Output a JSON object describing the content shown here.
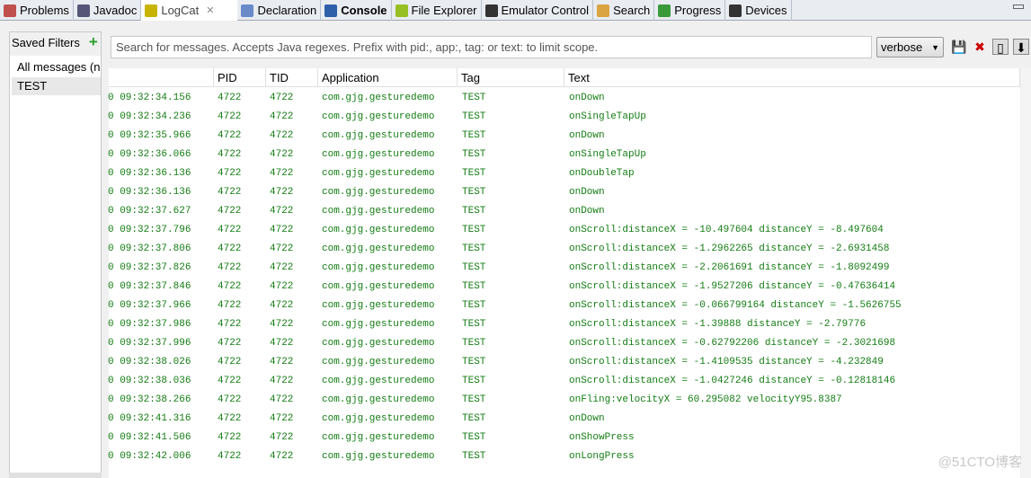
{
  "tabs": [
    {
      "label": "Problems",
      "icon": "problems-icon",
      "color": "#c0504d"
    },
    {
      "label": "Javadoc",
      "icon": "at-icon",
      "color": "#557"
    },
    {
      "label": "LogCat",
      "icon": "logcat-icon",
      "color": "#c8b400",
      "active": true
    },
    {
      "label": "Declaration",
      "icon": "declaration-icon",
      "color": "#6a8ac8"
    },
    {
      "label": "Console",
      "icon": "console-icon",
      "color": "#2e5fa8",
      "bold": true
    },
    {
      "label": "File Explorer",
      "icon": "android-icon",
      "color": "#97c024"
    },
    {
      "label": "Emulator Control",
      "icon": "emulator-icon",
      "color": "#333"
    },
    {
      "label": "Search",
      "icon": "search-icon",
      "color": "#d9a441"
    },
    {
      "label": "Progress",
      "icon": "progress-icon",
      "color": "#3a9a3a"
    },
    {
      "label": "Devices",
      "icon": "device-icon",
      "color": "#333"
    }
  ],
  "filters": {
    "title": "Saved Filters",
    "items": [
      "All messages (n",
      "TEST"
    ]
  },
  "search": {
    "placeholder": "Search for messages. Accepts Java regexes. Prefix with pid:, app:, tag: or text: to limit scope."
  },
  "level": "verbose",
  "columns": [
    "",
    "PID",
    "TID",
    "Application",
    "Tag",
    "Text"
  ],
  "rows": [
    [
      "0 09:32:34.156",
      "4722",
      "4722",
      "com.gjg.gesturedemo",
      "TEST",
      "onDown"
    ],
    [
      "0 09:32:34.236",
      "4722",
      "4722",
      "com.gjg.gesturedemo",
      "TEST",
      "onSingleTapUp"
    ],
    [
      "0 09:32:35.966",
      "4722",
      "4722",
      "com.gjg.gesturedemo",
      "TEST",
      "onDown"
    ],
    [
      "0 09:32:36.066",
      "4722",
      "4722",
      "com.gjg.gesturedemo",
      "TEST",
      "onSingleTapUp"
    ],
    [
      "0 09:32:36.136",
      "4722",
      "4722",
      "com.gjg.gesturedemo",
      "TEST",
      "onDoubleTap"
    ],
    [
      "0 09:32:36.136",
      "4722",
      "4722",
      "com.gjg.gesturedemo",
      "TEST",
      "onDown"
    ],
    [
      "0 09:32:37.627",
      "4722",
      "4722",
      "com.gjg.gesturedemo",
      "TEST",
      "onDown"
    ],
    [
      "0 09:32:37.796",
      "4722",
      "4722",
      "com.gjg.gesturedemo",
      "TEST",
      "onScroll:distanceX = -10.497604 distanceY = -8.497604"
    ],
    [
      "0 09:32:37.806",
      "4722",
      "4722",
      "com.gjg.gesturedemo",
      "TEST",
      "onScroll:distanceX = -1.2962265 distanceY = -2.6931458"
    ],
    [
      "0 09:32:37.826",
      "4722",
      "4722",
      "com.gjg.gesturedemo",
      "TEST",
      "onScroll:distanceX = -2.2061691 distanceY = -1.8092499"
    ],
    [
      "0 09:32:37.846",
      "4722",
      "4722",
      "com.gjg.gesturedemo",
      "TEST",
      "onScroll:distanceX = -1.9527206 distanceY = -0.47636414"
    ],
    [
      "0 09:32:37.966",
      "4722",
      "4722",
      "com.gjg.gesturedemo",
      "TEST",
      "onScroll:distanceX = -0.066799164 distanceY = -1.5626755"
    ],
    [
      "0 09:32:37.986",
      "4722",
      "4722",
      "com.gjg.gesturedemo",
      "TEST",
      "onScroll:distanceX = -1.39888 distanceY = -2.79776"
    ],
    [
      "0 09:32:37.996",
      "4722",
      "4722",
      "com.gjg.gesturedemo",
      "TEST",
      "onScroll:distanceX = -0.62792206 distanceY = -2.3021698"
    ],
    [
      "0 09:32:38.026",
      "4722",
      "4722",
      "com.gjg.gesturedemo",
      "TEST",
      "onScroll:distanceX = -1.4109535 distanceY = -4.232849"
    ],
    [
      "0 09:32:38.036",
      "4722",
      "4722",
      "com.gjg.gesturedemo",
      "TEST",
      "onScroll:distanceX = -1.0427246 distanceY = -0.12818146"
    ],
    [
      "0 09:32:38.266",
      "4722",
      "4722",
      "com.gjg.gesturedemo",
      "TEST",
      "onFling:velocityX = 60.295082 velocityY95.8387"
    ],
    [
      "0 09:32:41.316",
      "4722",
      "4722",
      "com.gjg.gesturedemo",
      "TEST",
      "onDown"
    ],
    [
      "0 09:32:41.506",
      "4722",
      "4722",
      "com.gjg.gesturedemo",
      "TEST",
      "onShowPress"
    ],
    [
      "0 09:32:42.006",
      "4722",
      "4722",
      "com.gjg.gesturedemo",
      "TEST",
      "onLongPress"
    ]
  ],
  "watermark": "@51CTO博客"
}
